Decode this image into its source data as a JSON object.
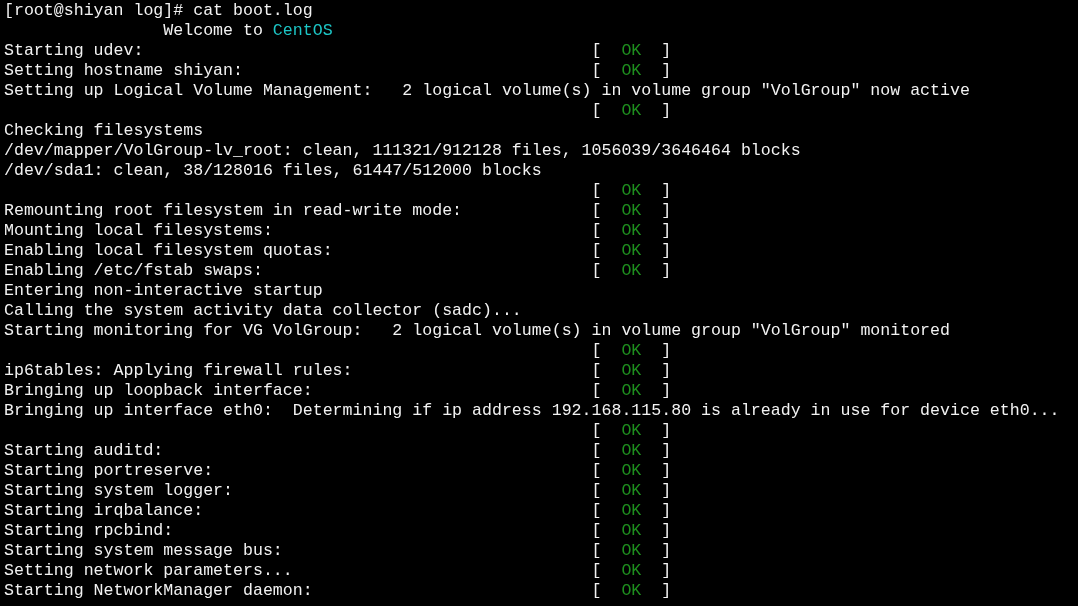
{
  "terminal": {
    "lines": [
      {
        "kind": "prompt",
        "text": "[root@shiyan log]# cat boot.log"
      },
      {
        "kind": "banner",
        "text": "Welcome to",
        "highlight": "CentOS"
      },
      {
        "kind": "log",
        "text": "Starting udev:",
        "status": {
          "left": "[",
          "label": "OK",
          "right": "]"
        }
      },
      {
        "kind": "log",
        "text": "Setting hostname shiyan:",
        "status": {
          "left": "[",
          "label": "OK",
          "right": "]"
        }
      },
      {
        "kind": "log",
        "text": "Setting up Logical Volume Management:   2 logical volume(s) in volume group \"VolGroup\" now active"
      },
      {
        "kind": "log",
        "status": {
          "left": "[",
          "label": "OK",
          "right": "]"
        }
      },
      {
        "kind": "log",
        "text": "Checking filesystems"
      },
      {
        "kind": "log",
        "text": "/dev/mapper/VolGroup-lv_root: clean, 111321/912128 files, 1056039/3646464 blocks"
      },
      {
        "kind": "log",
        "text": "/dev/sda1: clean, 38/128016 files, 61447/512000 blocks"
      },
      {
        "kind": "log",
        "status": {
          "left": "[",
          "label": "OK",
          "right": "]"
        }
      },
      {
        "kind": "log",
        "text": "Remounting root filesystem in read-write mode:",
        "status": {
          "left": "[",
          "label": "OK",
          "right": "]"
        }
      },
      {
        "kind": "log",
        "text": "Mounting local filesystems:",
        "status": {
          "left": "[",
          "label": "OK",
          "right": "]"
        }
      },
      {
        "kind": "log",
        "text": "Enabling local filesystem quotas:",
        "status": {
          "left": "[",
          "label": "OK",
          "right": "]"
        }
      },
      {
        "kind": "log",
        "text": "Enabling /etc/fstab swaps:",
        "status": {
          "left": "[",
          "label": "OK",
          "right": "]"
        }
      },
      {
        "kind": "log",
        "text": "Entering non-interactive startup"
      },
      {
        "kind": "log",
        "text": "Calling the system activity data collector (sadc)..."
      },
      {
        "kind": "log",
        "text": "Starting monitoring for VG VolGroup:   2 logical volume(s) in volume group \"VolGroup\" monitored"
      },
      {
        "kind": "log",
        "status": {
          "left": "[",
          "label": "OK",
          "right": "]"
        }
      },
      {
        "kind": "log",
        "text": "ip6tables: Applying firewall rules:",
        "status": {
          "left": "[",
          "label": "OK",
          "right": "]"
        }
      },
      {
        "kind": "log",
        "text": "Bringing up loopback interface:",
        "status": {
          "left": "[",
          "label": "OK",
          "right": "]"
        }
      },
      {
        "kind": "log",
        "text": "Bringing up interface eth0:  Determining if ip address 192.168.115.80 is already in use for device eth0..."
      },
      {
        "kind": "log",
        "status": {
          "left": "[",
          "label": "OK",
          "right": "]"
        }
      },
      {
        "kind": "log",
        "text": "Starting auditd:",
        "status": {
          "left": "[",
          "label": "OK",
          "right": "]"
        }
      },
      {
        "kind": "log",
        "text": "Starting portreserve:",
        "status": {
          "left": "[",
          "label": "OK",
          "right": "]"
        }
      },
      {
        "kind": "log",
        "text": "Starting system logger:",
        "status": {
          "left": "[",
          "label": "OK",
          "right": "]"
        }
      },
      {
        "kind": "log",
        "text": "Starting irqbalance:",
        "status": {
          "left": "[",
          "label": "OK",
          "right": "]"
        }
      },
      {
        "kind": "log",
        "text": "Starting rpcbind:",
        "status": {
          "left": "[",
          "label": "OK",
          "right": "]"
        }
      },
      {
        "kind": "log",
        "text": "Starting system message bus:",
        "status": {
          "left": "[",
          "label": "OK",
          "right": "]"
        }
      },
      {
        "kind": "log",
        "text": "Setting network parameters...",
        "status": {
          "left": "[",
          "label": "OK",
          "right": "]"
        }
      },
      {
        "kind": "log",
        "text": "Starting NetworkManager daemon:",
        "status": {
          "left": "[",
          "label": "OK",
          "right": "]"
        }
      }
    ]
  }
}
